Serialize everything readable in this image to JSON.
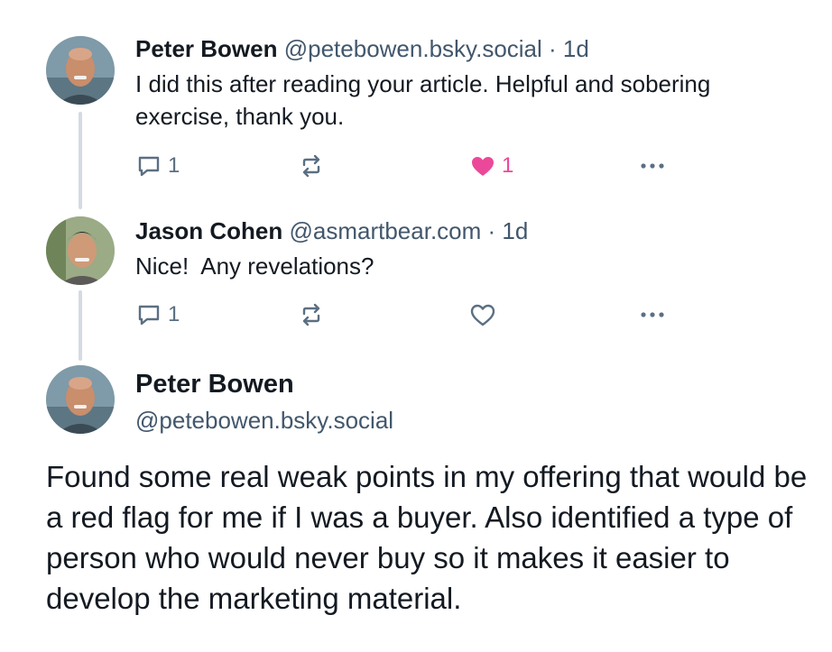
{
  "posts": [
    {
      "author_name": "Peter Bowen",
      "handle": "@petebowen.bsky.social",
      "time": "· 1d",
      "text": "I did this after reading your article. Helpful and sobering exercise, thank you.",
      "reply_count": "1",
      "like_count": "1",
      "liked": true
    },
    {
      "author_name": "Jason Cohen",
      "handle": "@asmartbear.com",
      "time": "· 1d",
      "text": "Nice!  Any revelations?",
      "reply_count": "1",
      "like_count": "",
      "liked": false
    }
  ],
  "main_post": {
    "author_name": "Peter Bowen",
    "handle": "@petebowen.bsky.social",
    "text": "Found some real weak points in my offering that would be a red flag for me if I was a buyer. Also identified a type of person who would never buy so it makes it easier to develop the marketing material."
  },
  "colors": {
    "like_active": "#ec4899",
    "icon_muted": "#5b6f82",
    "thread_line": "#d4dbe2",
    "handle_text": "#42576c"
  }
}
